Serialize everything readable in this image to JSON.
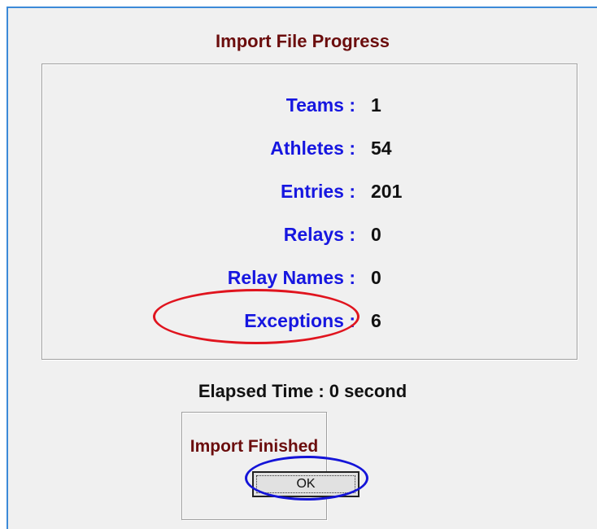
{
  "dialog": {
    "title": "Import File Progress",
    "stats": [
      {
        "label": "Teams :",
        "value": "1"
      },
      {
        "label": "Athletes :",
        "value": "54"
      },
      {
        "label": "Entries :",
        "value": "201"
      },
      {
        "label": "Relays :",
        "value": "0"
      },
      {
        "label": "Relay Names :",
        "value": "0"
      },
      {
        "label": "Exceptions :",
        "value": "6"
      }
    ],
    "elapsed_time": "Elapsed Time :  0 second",
    "status": "Import Finished",
    "ok_label": "OK"
  },
  "annotations": {
    "exceptions_highlight_color": "#e0141e",
    "ok_highlight_color": "#1414d8"
  },
  "colors": {
    "title": "#6b0d0d",
    "label": "#1616e0",
    "value": "#111111",
    "background": "#f0f0f0"
  }
}
